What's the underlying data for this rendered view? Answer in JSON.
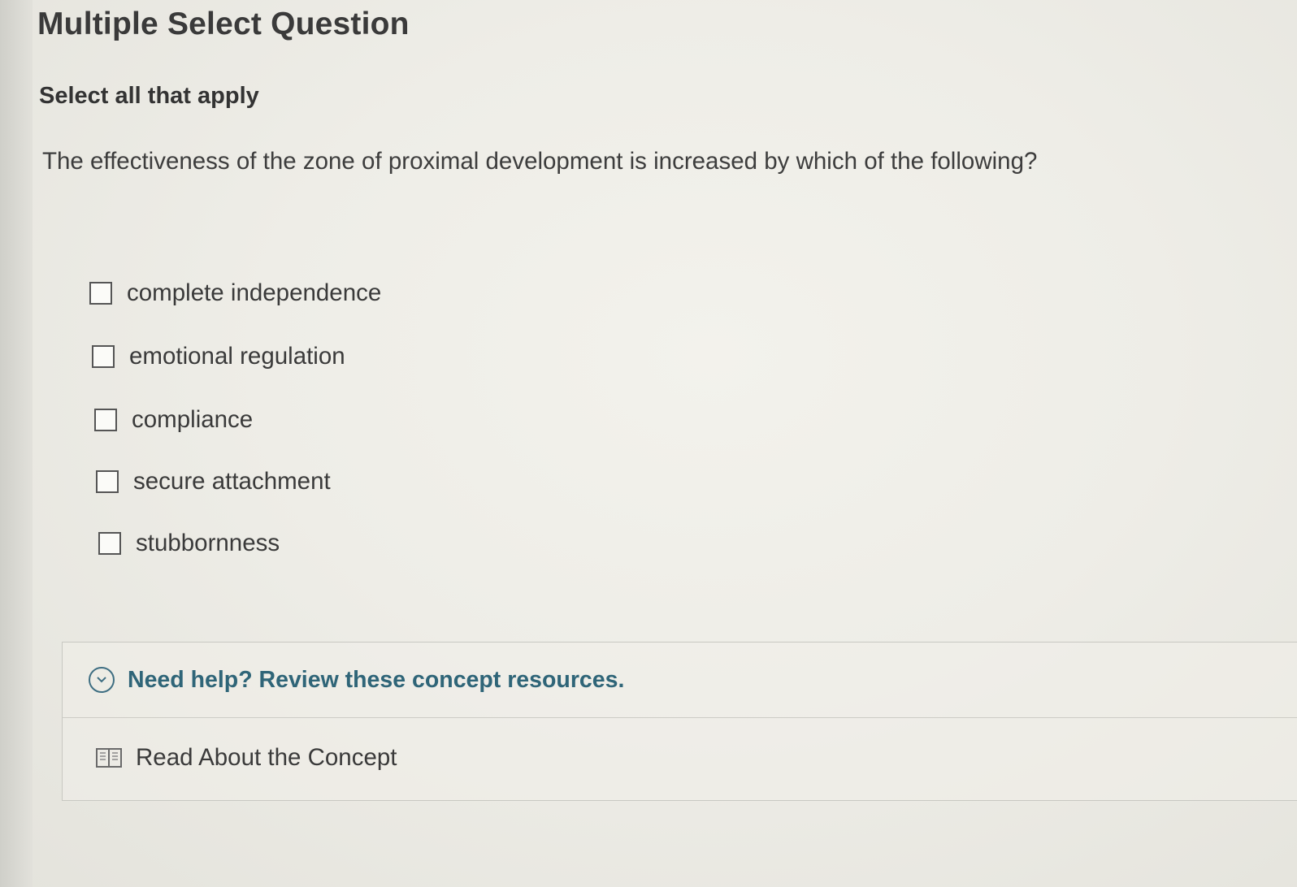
{
  "question": {
    "type_label": "Multiple Select Question",
    "instruction": "Select all that apply",
    "prompt": "The effectiveness of the zone of proximal development is increased by which of the following?"
  },
  "options": [
    {
      "label": "complete independence",
      "checked": false
    },
    {
      "label": "emotional regulation",
      "checked": false
    },
    {
      "label": "compliance",
      "checked": false
    },
    {
      "label": "secure attachment",
      "checked": false
    },
    {
      "label": "stubbornness",
      "checked": false
    }
  ],
  "help": {
    "title": "Need help? Review these concept resources.",
    "icon": "chevron-down-circle-icon",
    "resources": [
      {
        "label": "Read About the Concept",
        "icon": "book-icon"
      }
    ]
  },
  "colors": {
    "accent": "#2f6578",
    "text": "#3a3a3a",
    "background": "#eeede7"
  }
}
